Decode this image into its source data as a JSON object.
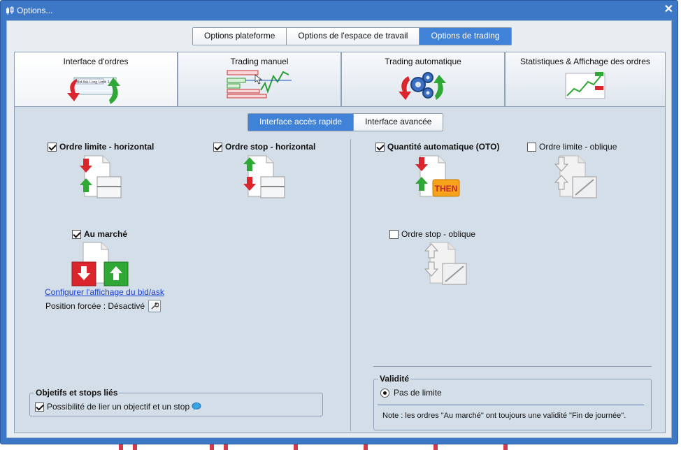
{
  "window": {
    "title": "Options...",
    "close_label": "✕"
  },
  "top_tabs": [
    {
      "label": "Options plateforme",
      "active": false
    },
    {
      "label": "Options de l'espace de travail",
      "active": false
    },
    {
      "label": "Options de trading",
      "active": true
    }
  ],
  "main_tabs": [
    {
      "label": "Interface d'ordres",
      "icon": "order-interface-icon",
      "active": true,
      "preview_text": "Bid Ask Long Limit: 1"
    },
    {
      "label": "Trading manuel",
      "icon": "manual-trading-icon",
      "active": false
    },
    {
      "label": "Trading automatique",
      "icon": "automatic-trading-icon",
      "active": false
    },
    {
      "label": "Statistiques & Affichage des ordres",
      "icon": "statistics-display-icon",
      "active": false
    }
  ],
  "sub_tabs": [
    {
      "label": "Interface accès rapide",
      "active": true
    },
    {
      "label": "Interface avancée",
      "active": false
    }
  ],
  "options": {
    "limit_horizontal": {
      "label": "Ordre limite - horizontal",
      "checked": true,
      "icon": "limit-order-horizontal-icon"
    },
    "stop_horizontal": {
      "label": "Ordre stop - horizontal",
      "checked": true,
      "icon": "stop-order-horizontal-icon"
    },
    "auto_quantity": {
      "label": "Quantité automatique (OTO)",
      "checked": true,
      "icon": "oto-then-icon",
      "badge": "THEN"
    },
    "limit_oblique": {
      "label": "Ordre limite - oblique",
      "checked": false,
      "icon": "limit-order-oblique-icon"
    },
    "market": {
      "label": "Au marché",
      "checked": true,
      "icon": "market-order-icon"
    },
    "stop_oblique": {
      "label": "Ordre stop - oblique",
      "checked": false,
      "icon": "stop-order-oblique-icon"
    }
  },
  "bid_ask_link": "Configurer l'affichage du bid/ask",
  "forced_position": {
    "label": "Position forcée : Désactivé",
    "icon": "wrench-icon"
  },
  "linked_targets": {
    "title": "Objetifs et stops liés",
    "checkbox_label": "Possibilité de lier un objectif et un stop",
    "checked": true,
    "icon": "info-bubble-icon"
  },
  "validity": {
    "title": "Validité",
    "radio_label": "Pas de limite",
    "selected": true,
    "note": "Note : les ordres \"Au marché\" ont toujours une validité \"Fin de journée\"."
  },
  "colors": {
    "accent": "#3f82d8",
    "title_bar": "#3d78c7",
    "panel": "#d4dee8",
    "arrow_red": "#d9252b",
    "arrow_green": "#2fa836"
  }
}
